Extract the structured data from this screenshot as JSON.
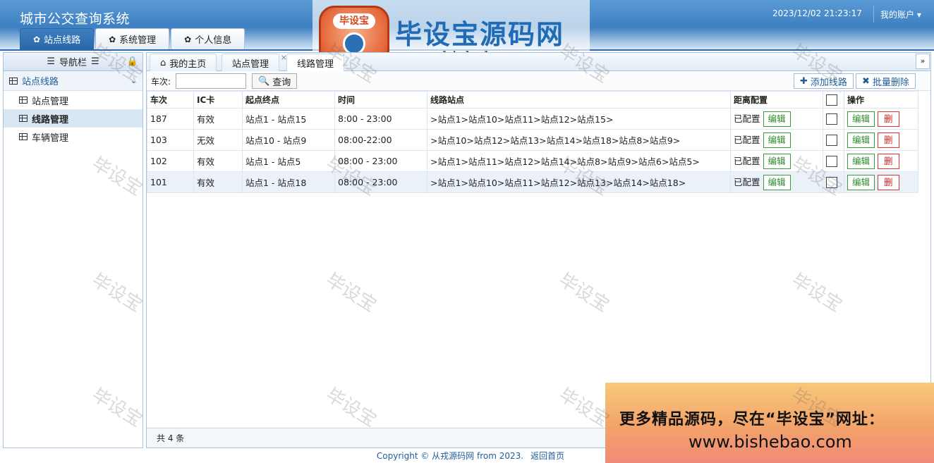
{
  "app": {
    "title": "城市公交查询系统",
    "datetime": "2023/12/02 21:23:17",
    "account": "我的账户 ▾"
  },
  "top_tabs": [
    {
      "label": "站点线路",
      "icon": "gear-icon",
      "active": true
    },
    {
      "label": "系统管理",
      "icon": "gear-icon",
      "active": false
    },
    {
      "label": "个人信息",
      "icon": "gear-icon",
      "active": false
    }
  ],
  "logo": {
    "main": "毕设宝源码网",
    "sub": "www.bishebao.com",
    "badge": "毕设宝"
  },
  "nav": {
    "header": "导航栏",
    "group": "站点线路",
    "items": [
      {
        "label": "站点管理",
        "active": false
      },
      {
        "label": "线路管理",
        "active": true
      },
      {
        "label": "车辆管理",
        "active": false
      }
    ]
  },
  "page_tabs": [
    {
      "label": "我的主页",
      "icon": "home-icon"
    },
    {
      "label": "站点管理"
    },
    {
      "label": "线路管理",
      "active": true
    }
  ],
  "toolbar": {
    "label": "车次:",
    "search_value": "",
    "search_button": "查询",
    "add_button": "添加线路",
    "batch_delete_button": "批量删除"
  },
  "table": {
    "headers": [
      "车次",
      "IC卡",
      "起点终点",
      "时间",
      "线路站点",
      "距离配置",
      "",
      "操作"
    ],
    "rows": [
      {
        "no": "187",
        "ic": "有效",
        "endpoints": "站点1 - 站点15",
        "time": "8:00 - 23:00",
        "stations": ">站点1>站点10>站点11>站点12>站点15>",
        "dist": "已配置"
      },
      {
        "no": "103",
        "ic": "无效",
        "endpoints": "站点10 - 站点9",
        "time": "08:00-22:00",
        "stations": ">站点10>站点12>站点13>站点14>站点18>站点8>站点9>",
        "dist": "已配置"
      },
      {
        "no": "102",
        "ic": "有效",
        "endpoints": "站点1 - 站点5",
        "time": "08:00 - 23:00",
        "stations": ">站点1>站点11>站点12>站点14>站点8>站点9>站点6>站点5>",
        "dist": "已配置"
      },
      {
        "no": "101",
        "ic": "有效",
        "endpoints": "站点1 - 站点18",
        "time": "08:00 - 23:00",
        "stations": ">站点1>站点10>站点11>站点12>站点13>站点14>站点18>",
        "dist": "已配置"
      }
    ],
    "edit_label": "编辑",
    "delete_label": "删"
  },
  "footer": {
    "count": "共 4 条",
    "copyright": "Copyright © 从戎源码网 from 2023.",
    "home_link": "返回首页"
  },
  "promo": {
    "line1": "更多精品源码，尽在“毕设宝”网址：",
    "line2": "www.bishebao.com"
  },
  "watermark": "毕设宝"
}
